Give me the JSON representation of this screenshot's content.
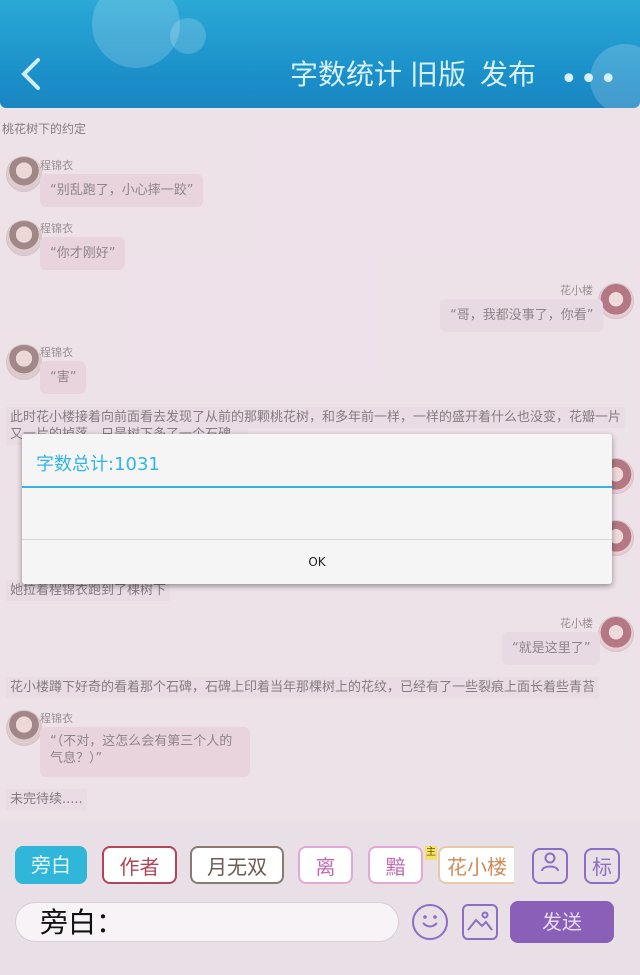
{
  "header": {
    "back_icon": "chevron-left-icon",
    "word_count_label": "字数统计",
    "old_version_label": "旧版",
    "publish_label": "发布",
    "more_icon": "more-dots-icon",
    "more_glyph": "•••"
  },
  "story_title": "桃花树下的约定",
  "messages": [
    {
      "name": "程锦衣",
      "text": "“别乱跑了，小心摔一跤”"
    },
    {
      "name": "程锦衣",
      "text": "“你才刚好”"
    },
    {
      "name": "花小楼",
      "text": "“哥，我都没事了，你看”"
    },
    {
      "name": "程锦衣",
      "text": "“害”"
    },
    {
      "name": "花小楼",
      "text": "“就是这里了”"
    },
    {
      "name": "程锦衣",
      "text": "“（不对，这怎么会有第三个人的"
    },
    {
      "name": "",
      "text": "气息？）”"
    }
  ],
  "narrations": [
    "此时花小楼接着向前面看去发现了从前的那颗桃花树，和多年前一样，一样的盛开着什么也没变，花瓣一片",
    "又一片的掉落，只是树下多了一个石碑。",
    "她拉着程锦衣跑到了棵树下",
    "花小楼蹲下好奇的看着那个石碑，石碑上印着当年那棵树上的花纹，已经有了一些裂痕上面长着些青苔",
    "未完待续....."
  ],
  "dialog": {
    "title": "字数总计:1031",
    "ok_label": "OK"
  },
  "characters": [
    {
      "label": "旁白",
      "selected": true
    },
    {
      "label": "作者"
    },
    {
      "label": "月无双"
    },
    {
      "label": "离"
    },
    {
      "label": "黯"
    },
    {
      "label": "花小楼"
    }
  ],
  "main_badge": "主",
  "tools": {
    "person_icon": "person-icon",
    "mark_label": "标"
  },
  "input": {
    "value": "旁白："
  },
  "emoji_icon": "smiley-icon",
  "image_icon": "image-icon",
  "send_label": "发送",
  "colors": {
    "accent": "#33b5e5",
    "header": "#1b8fc9",
    "send": "#8a5fb8",
    "selected_chip": "#2fb6d8"
  }
}
